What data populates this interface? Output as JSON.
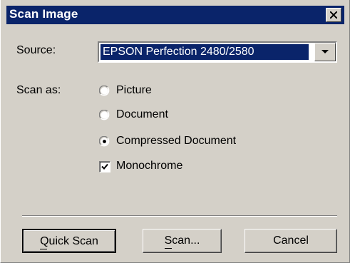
{
  "window": {
    "title": "Scan Image",
    "close_icon": "close-icon"
  },
  "source": {
    "label": "Source:",
    "selected": "EPSON Perfection 2480/2580"
  },
  "scan_as": {
    "label": "Scan as:",
    "options": [
      {
        "label": "Picture",
        "selected": false
      },
      {
        "label": "Document",
        "selected": false
      },
      {
        "label": "Compressed Document",
        "selected": true
      }
    ],
    "monochrome": {
      "label": "Monochrome",
      "checked": true
    }
  },
  "buttons": {
    "quick_scan": "Quick Scan",
    "scan": "Scan...",
    "cancel": "Cancel"
  },
  "colors": {
    "titlebar": "#0a246a",
    "face": "#d4d0c8",
    "selection": "#0a246a"
  }
}
